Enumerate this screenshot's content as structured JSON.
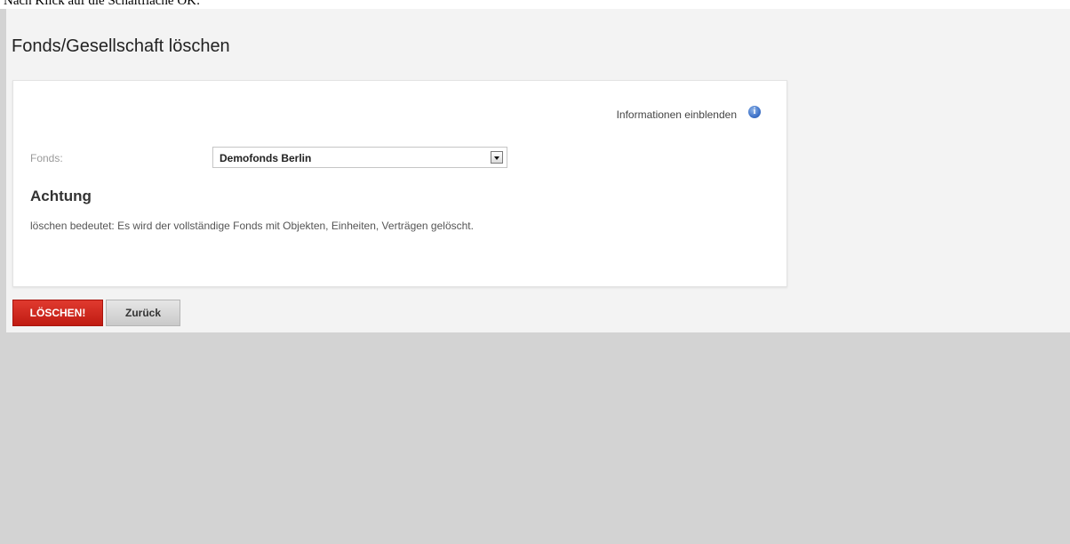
{
  "caption": "Nach Klick auf die Schaltfläche OK:",
  "page": {
    "title": "Fonds/Gesellschaft löschen"
  },
  "panel": {
    "info_link": "Informationen einblenden",
    "info_icon": "info-icon",
    "fonds_label": "Fonds:",
    "fonds_value": "Demofonds Berlin",
    "warning_title": "Achtung",
    "warning_text": "löschen bedeutet: Es wird der vollständige Fonds mit Objekten, Einheiten, Verträgen gelöscht."
  },
  "actions": {
    "delete_label": "LÖSCHEN!",
    "back_label": "Zurück"
  },
  "colors": {
    "delete_button": "#d0281f",
    "page_background": "#f3f3f3",
    "outer_background": "#d3d3d3"
  }
}
